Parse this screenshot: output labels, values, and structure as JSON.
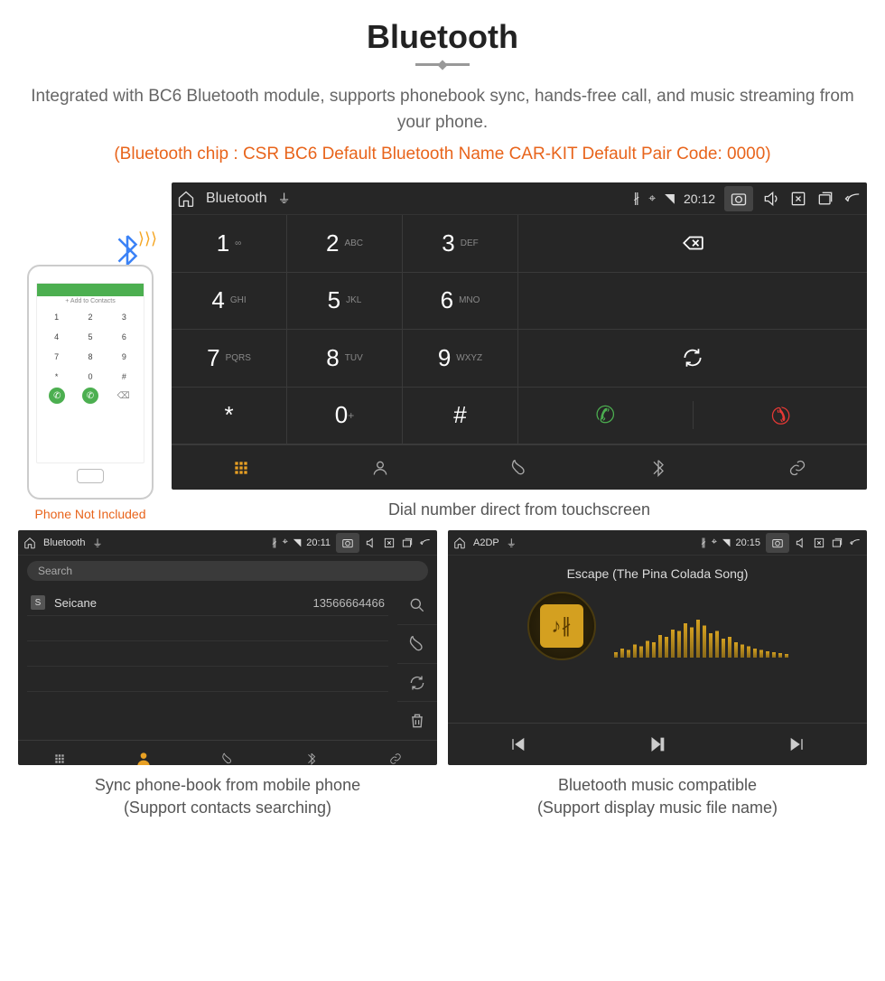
{
  "title": "Bluetooth",
  "subtitle": "Integrated with BC6 Bluetooth module, supports phonebook sync, hands-free call, and music streaming from your phone.",
  "orange_info": "(Bluetooth chip : CSR BC6    Default Bluetooth Name CAR-KIT    Default Pair Code: 0000)",
  "phone": {
    "add_contacts": "+  Add to Contacts",
    "caption": "Phone Not Included",
    "keys": [
      "1",
      "2",
      "3",
      "4",
      "5",
      "6",
      "7",
      "8",
      "9",
      "*",
      "0",
      "#"
    ]
  },
  "dialer": {
    "statusbar": {
      "title": "Bluetooth",
      "time": "20:12"
    },
    "keys": [
      {
        "n": "1",
        "a": "∞"
      },
      {
        "n": "2",
        "a": "ABC"
      },
      {
        "n": "3",
        "a": "DEF"
      },
      {
        "n": "4",
        "a": "GHI"
      },
      {
        "n": "5",
        "a": "JKL"
      },
      {
        "n": "6",
        "a": "MNO"
      },
      {
        "n": "7",
        "a": "PQRS"
      },
      {
        "n": "8",
        "a": "TUV"
      },
      {
        "n": "9",
        "a": "WXYZ"
      },
      {
        "n": "*",
        "a": ""
      },
      {
        "n": "0",
        "a": "+",
        "sup": true
      },
      {
        "n": "#",
        "a": ""
      }
    ],
    "caption": "Dial number direct from touchscreen"
  },
  "phonebook": {
    "statusbar": {
      "title": "Bluetooth",
      "time": "20:11"
    },
    "search_placeholder": "Search",
    "contact": {
      "badge": "S",
      "name": "Seicane",
      "number": "13566664466"
    },
    "caption1": "Sync phone-book from mobile phone",
    "caption2": "(Support contacts searching)"
  },
  "music": {
    "statusbar": {
      "title": "A2DP",
      "time": "20:15"
    },
    "song": "Escape (The Pina Colada Song)",
    "caption1": "Bluetooth music compatible",
    "caption2": "(Support display music file name)"
  }
}
